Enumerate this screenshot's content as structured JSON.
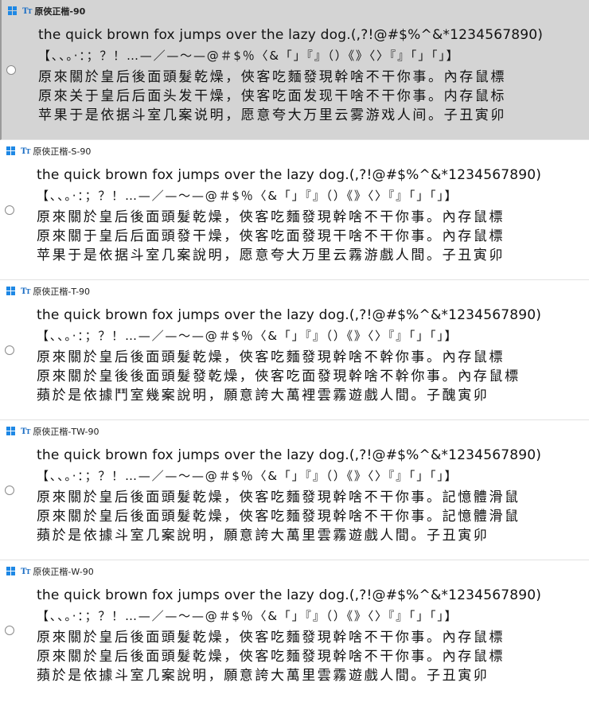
{
  "sample_latin": "the quick brown fox jumps over the lazy dog.(,?!@#$%^&*1234567890)",
  "sample_punct": "【、、。·：；？！…—／—～—@＃$％〈&「」『』（）《》〈〉『』「」「」】",
  "fonts": [
    {
      "name": "原俠正楷-90",
      "selected": true,
      "lines": [
        "原來關於皇后後面頭髮乾燥，俠客吃麵發現幹啥不干你事。內存鼠標",
        "原來关于皇后后面头发干燥，侠客吃面发现干啥不干你事。内存鼠标",
        "苹果于是依据斗室几案说明，愿意夸大万里云雾游戏人间。子丑寅卯"
      ]
    },
    {
      "name": "原俠正楷-S-90",
      "selected": false,
      "lines": [
        "原來關於皇后後面頭髮乾燥，俠客吃麵發現幹啥不干你事。內存鼠標",
        "原來關于皇后后面頭發干燥，俠客吃面發現干啥不干你事。內存鼠標",
        "苹果于是依据斗室几案說明，愿意夸大万里云霧游戲人間。子丑寅卯"
      ]
    },
    {
      "name": "原俠正楷-T-90",
      "selected": false,
      "lines": [
        "原來關於皇后後面頭髮乾燥，俠客吃麵發現幹啥不幹你事。內存鼠標",
        "原來關於皇後後面頭髮發乾燥，俠客吃面發現幹啥不幹你事。內存鼠標",
        "蘋於是依據鬥室幾案說明，願意誇大萬裡雲霧遊戲人間。子醜寅卯"
      ]
    },
    {
      "name": "原俠正楷-TW-90",
      "selected": false,
      "lines": [
        "原來關於皇后後面頭髮乾燥，俠客吃麵發現幹啥不干你事。記憶體滑鼠",
        "原來關於皇后後面頭髮乾燥，俠客吃麵發現幹啥不干你事。記憶體滑鼠",
        "蘋於是依據斗室几案說明，願意誇大萬里雲霧遊戲人間。子丑寅卯"
      ]
    },
    {
      "name": "原俠正楷-W-90",
      "selected": false,
      "lines": [
        "原來關於皇后後面頭髮乾燥，俠客吃麵發現幹啥不干你事。內存鼠標",
        "原來關於皇后後面頭髮乾燥，俠客吃麵發現幹啥不干你事。內存鼠標",
        "蘋於是依據斗室几案說明，願意誇大萬里雲霧遊戲人間。子丑寅卯"
      ]
    }
  ]
}
